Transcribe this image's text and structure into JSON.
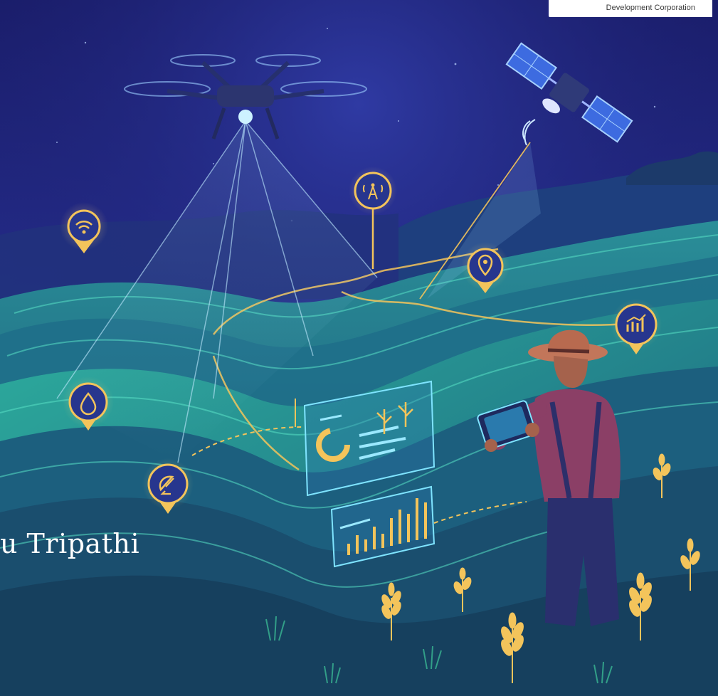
{
  "header": {
    "logo": {
      "org_line": "Development Corporation"
    }
  },
  "author": {
    "name_fragment": "u Tripathi"
  },
  "scene": {
    "subject": "farmer with tablet in terraced rice fields",
    "objects": [
      "drone",
      "satellite",
      "dashboard-panel",
      "bar-chart-panel"
    ],
    "pins": [
      "wifi-icon",
      "signal-tower-icon",
      "location-pin-icon",
      "growth-chart-icon",
      "water-drop-icon",
      "satellite-dish-icon"
    ],
    "colors": {
      "accent": "#f3c45b",
      "glow": "#7fd7ff",
      "field": "#2aa08f",
      "sky": "#232a86"
    }
  }
}
